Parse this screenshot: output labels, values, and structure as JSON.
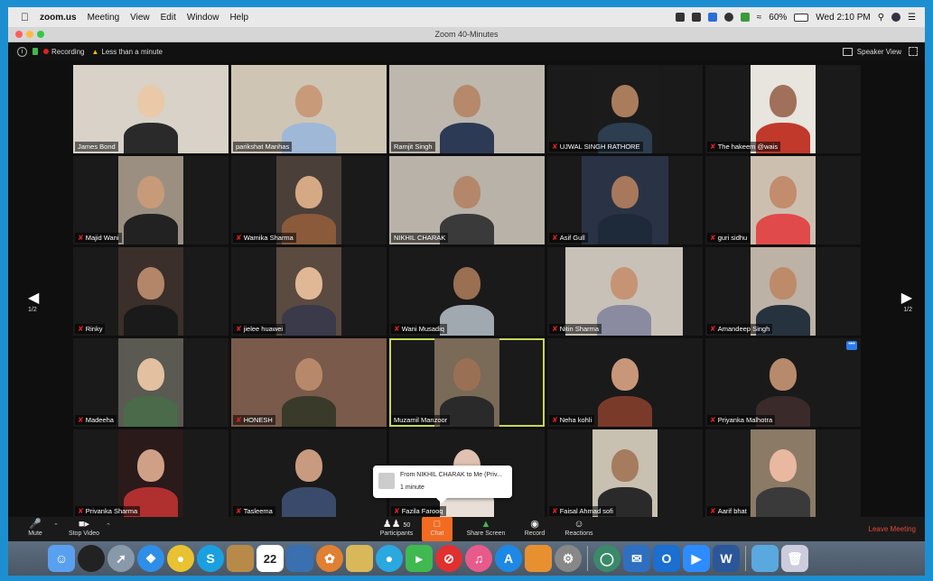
{
  "menubar": {
    "app": "zoom.us",
    "items": [
      "Meeting",
      "View",
      "Edit",
      "Window",
      "Help"
    ],
    "battery": "60%",
    "clock": "Wed 2:10 PM"
  },
  "window": {
    "title": "Zoom  40-Minutes"
  },
  "zoom_top": {
    "recording": "Recording",
    "duration": "Less than a minute",
    "speaker_view": "Speaker View"
  },
  "pager": {
    "left": "1/2",
    "right": "1/2"
  },
  "participants_grid": [
    {
      "name": "James Bond",
      "muted": false
    },
    {
      "name": "parikshat Manhas",
      "muted": false
    },
    {
      "name": "Ramjit Singh",
      "muted": false
    },
    {
      "name": "UJWAL SINGH RATHORE",
      "muted": true
    },
    {
      "name": "The hakeem @wais",
      "muted": true
    },
    {
      "name": "Majid Wani",
      "muted": true
    },
    {
      "name": "Wamika Sharma",
      "muted": true
    },
    {
      "name": "NIKHIL CHARAK",
      "muted": false
    },
    {
      "name": "Asif Gull",
      "muted": true
    },
    {
      "name": "guri sidhu",
      "muted": true
    },
    {
      "name": "Rinky",
      "muted": true
    },
    {
      "name": "jielee huawei",
      "muted": true
    },
    {
      "name": "Wani Musadiq",
      "muted": true
    },
    {
      "name": "Nitin Sharma",
      "muted": true
    },
    {
      "name": "Amandeep Singh",
      "muted": true
    },
    {
      "name": "Madeeha",
      "muted": true
    },
    {
      "name": "HONESH",
      "muted": true
    },
    {
      "name": "Muzamil Manzoor",
      "muted": false
    },
    {
      "name": "Neha kohli",
      "muted": true
    },
    {
      "name": "Priyanka Malhotra",
      "muted": true
    },
    {
      "name": "Privanka Sharma",
      "muted": true
    },
    {
      "name": "Tasleema",
      "muted": true
    },
    {
      "name": "Fazila Farooq",
      "muted": true
    },
    {
      "name": "Faisal Ahmad sofi",
      "muted": true
    },
    {
      "name": "Aarif bhat",
      "muted": true
    }
  ],
  "chat_popup": {
    "text": "From NIKHIL CHARAK to Me (Priv...",
    "time": "1 minute"
  },
  "controls": {
    "mute": "Mute",
    "stop_video": "Stop Video",
    "participants": "Participants",
    "participants_count": "50",
    "chat": "Chat",
    "share_screen": "Share Screen",
    "record": "Record",
    "reactions": "Reactions",
    "leave": "Leave Meeting"
  },
  "dock": {
    "calendar_day": "22",
    "skype": "S",
    "word": "W"
  },
  "colors": {
    "chat_accent": "#f26b21",
    "active_speaker": "#c7d65a",
    "leave": "#e0483a",
    "recording": "#e02020"
  }
}
